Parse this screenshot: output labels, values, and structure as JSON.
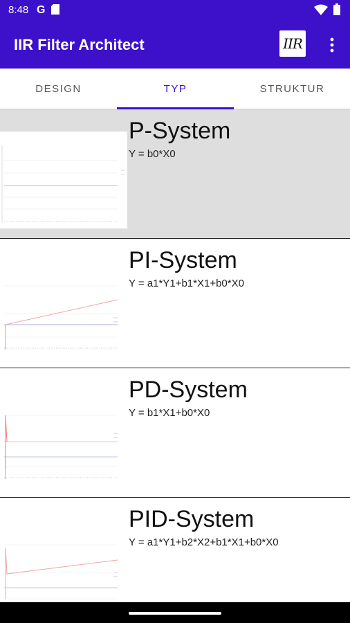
{
  "status": {
    "time": "8:48",
    "left_icons": [
      "google-icon",
      "sd-card-icon"
    ],
    "right_icons": [
      "wifi-icon",
      "battery-icon"
    ]
  },
  "appbar": {
    "title": "IIR Filter Architect",
    "logo_text": "IIR"
  },
  "tabs": [
    {
      "label": "DESIGN",
      "active": false
    },
    {
      "label": "TYP",
      "active": true
    },
    {
      "label": "STRUKTUR",
      "active": false
    }
  ],
  "items": [
    {
      "title": "P-System",
      "equation": "Y = b0*X0",
      "selected": true
    },
    {
      "title": "PI-System",
      "equation": "Y = a1*Y1+b1*X1+b0*X0",
      "selected": false
    },
    {
      "title": "PD-System",
      "equation": "Y = b1*X1+b0*X0",
      "selected": false
    },
    {
      "title": "PID-System",
      "equation": "Y = a1*Y1+b2*X2+b1*X1+b0*X0",
      "selected": false
    }
  ],
  "colors": {
    "primary": "#3d10c9",
    "selected_bg": "#dedede"
  }
}
